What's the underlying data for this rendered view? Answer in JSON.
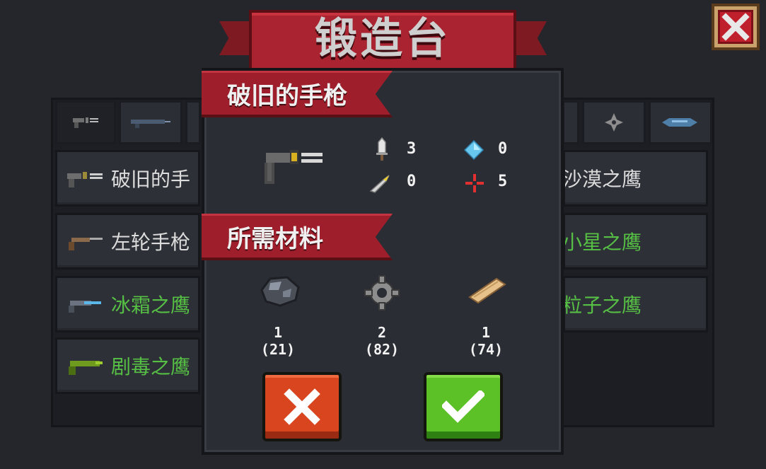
{
  "title": "锻造台",
  "list_rows": [
    {
      "label": "破旧的手",
      "color": "#dcdcdc"
    },
    {
      "label": "左轮手枪",
      "color": "#dcdcdc"
    },
    {
      "label": "冰霜之鹰",
      "color": "#56c045"
    },
    {
      "label": "剧毒之鹰",
      "color": "#56c045"
    }
  ],
  "list_rows_right": [
    {
      "label": "沙漠之鹰",
      "color": "#dcdcdc"
    },
    {
      "label": "小星之鹰",
      "color": "#56c045"
    },
    {
      "label": "粒子之鹰",
      "color": "#56c045"
    }
  ],
  "modal": {
    "weapon_name": "破旧的手枪",
    "stats": {
      "damage": "3",
      "energy": "0",
      "crit": "0",
      "accuracy": "5"
    },
    "materials_heading": "所需材料",
    "materials": [
      {
        "icon": "ore-icon",
        "required": "1",
        "owned": "(21)"
      },
      {
        "icon": "gear-part-icon",
        "required": "2",
        "owned": "(82)"
      },
      {
        "icon": "wood-plank-icon",
        "required": "1",
        "owned": "(74)"
      }
    ]
  },
  "colors": {
    "banner_red": "#a92330",
    "cancel_orange": "#d8451f",
    "confirm_green": "#5cc027",
    "rare_green": "#56c045"
  }
}
